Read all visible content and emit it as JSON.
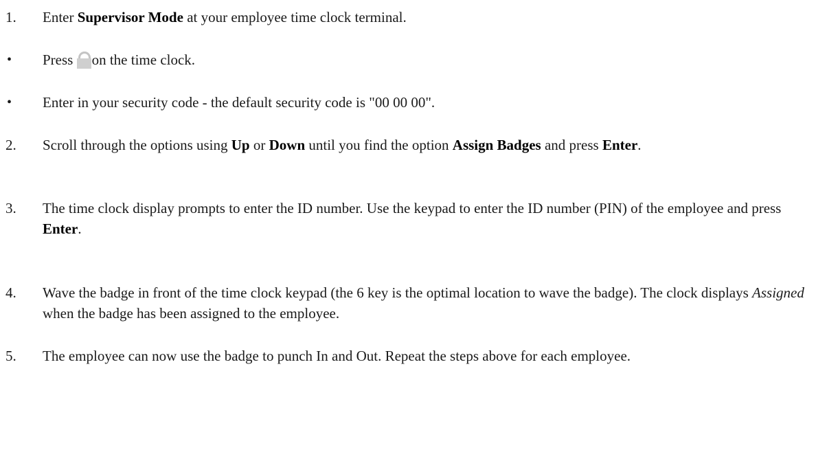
{
  "steps": [
    {
      "marker": "1.",
      "text": {
        "a": "Enter ",
        "b": "Supervisor Mode",
        "c": " at your employee time clock terminal."
      }
    },
    {
      "marker": "•",
      "text": {
        "a": "Press ",
        "c": "on the time clock."
      },
      "icon": "lock-icon"
    },
    {
      "marker": "•",
      "text": {
        "a": "Enter in your security code - the default security code is \"00 00 00\"."
      }
    },
    {
      "marker": "2.",
      "text": {
        "a": "Scroll through the options using ",
        "b1": "Up",
        "c1": " or ",
        "b2": "Down",
        "c2": " until you find the option ",
        "b3": "Assign Badges",
        "c3": " and press ",
        "b4": "Enter",
        "c4": "."
      }
    },
    {
      "marker": "3.",
      "text": {
        "a": "The time clock display prompts to enter the ID number. Use the keypad to enter the ID number (PIN) of the employee and press ",
        "b": "Enter",
        "c": "."
      }
    },
    {
      "marker": "4.",
      "text": {
        "a": "Wave the badge in front of the time clock keypad (the 6 key is the optimal location to wave the badge). The clock displays ",
        "i": "Assigned",
        "c": " when the badge has been assigned to the employee."
      }
    },
    {
      "marker": "5.",
      "text": {
        "a": "The employee can now use the badge to punch In and Out. Repeat the steps above for each employee."
      }
    }
  ]
}
